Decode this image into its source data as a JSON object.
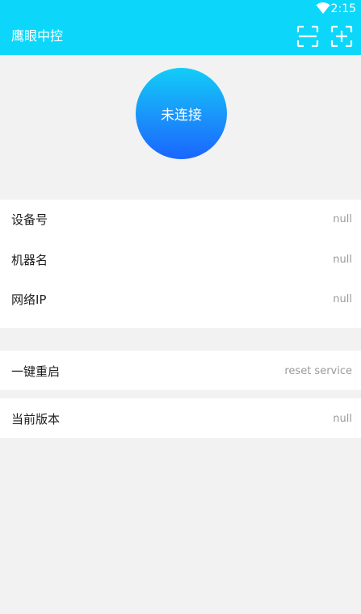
{
  "status_bar": {
    "time": "2:15",
    "wifi_icon": "wifi-icon"
  },
  "app_bar": {
    "title": "鹰眼中控",
    "bg_color": "#0cd7fb",
    "actions": [
      {
        "icon": "scan-icon"
      },
      {
        "icon": "add-icon"
      }
    ]
  },
  "connection": {
    "status": "未连接"
  },
  "device_info": [
    {
      "label": "设备号",
      "value": "null"
    },
    {
      "label": "机器名",
      "value": "null"
    },
    {
      "label": "网络IP",
      "value": "null"
    }
  ],
  "restart": {
    "label": "一键重启",
    "value": "reset service"
  },
  "version": {
    "label": "当前版本",
    "value": "null"
  }
}
